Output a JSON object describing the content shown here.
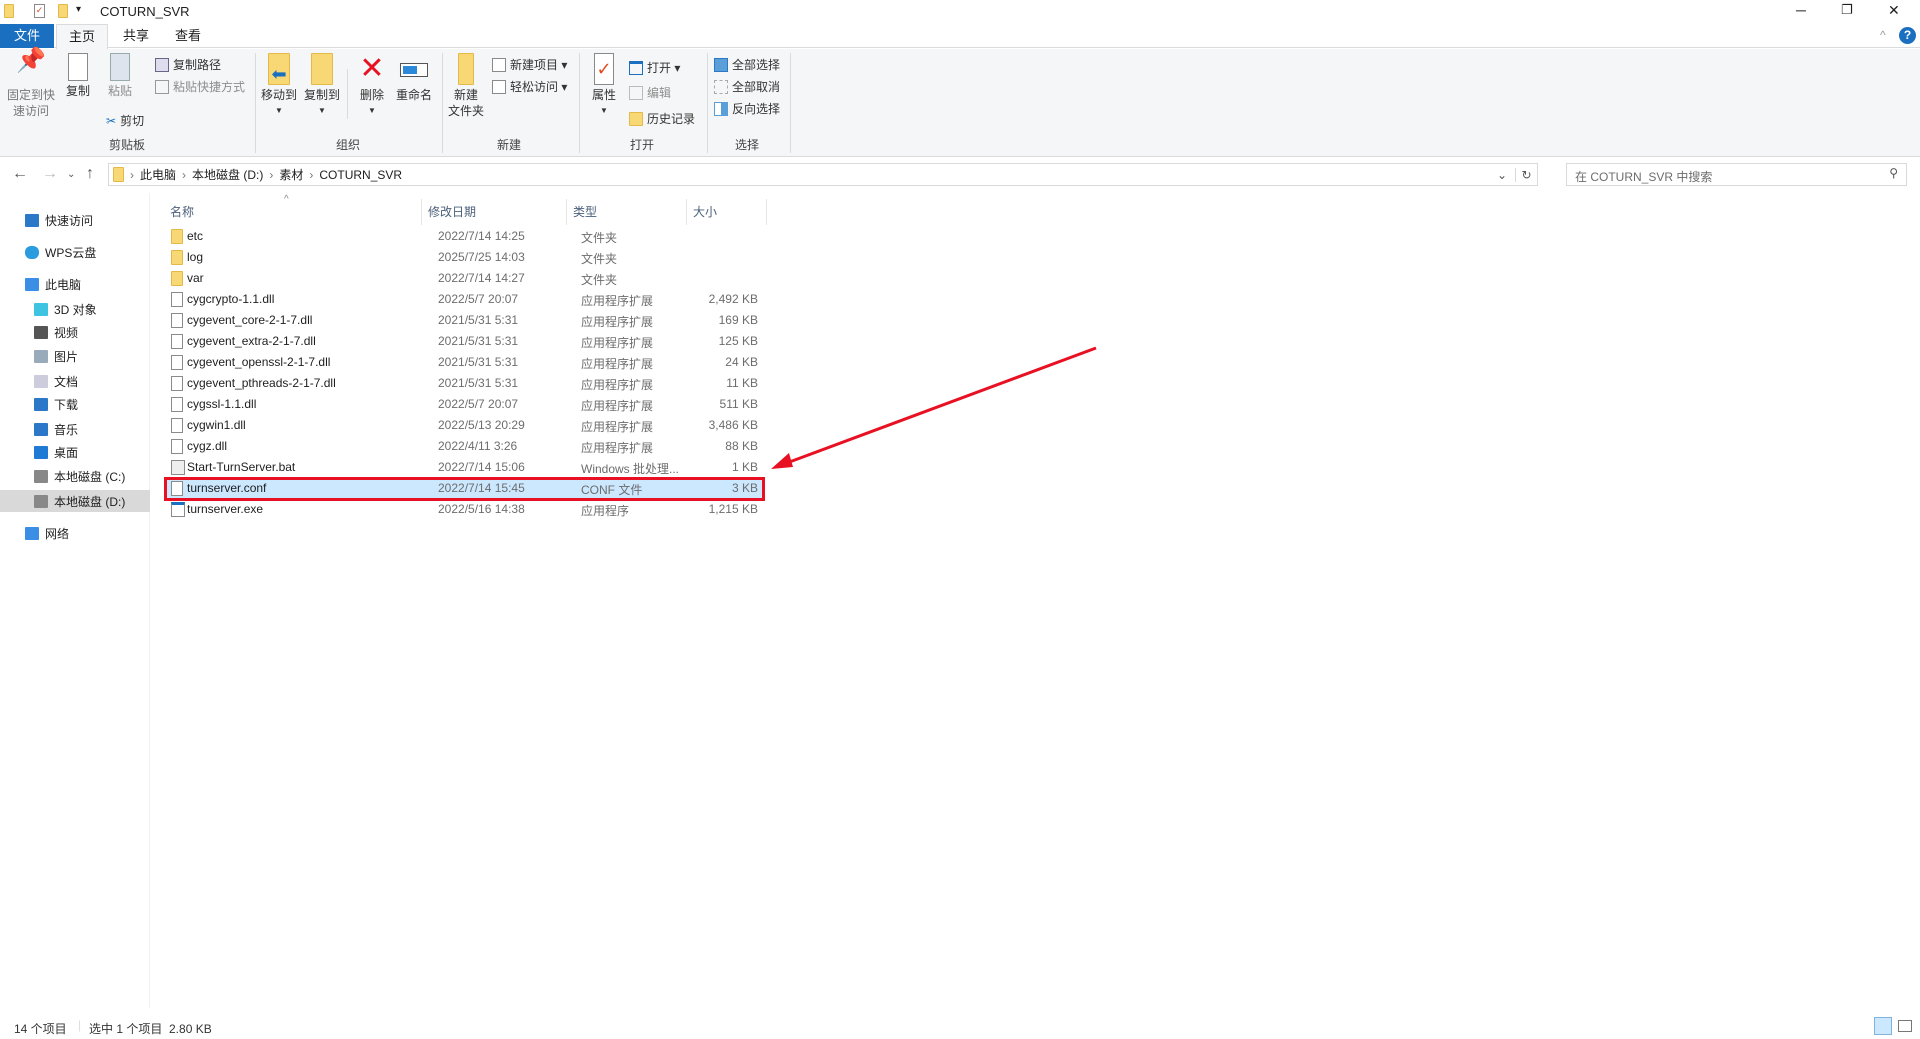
{
  "window": {
    "title": "COTURN_SVR",
    "minimize": "─",
    "restore": "❐",
    "close": "✕",
    "help": "?",
    "collapse": "^"
  },
  "tabs": [
    "文件",
    "主页",
    "共享",
    "查看"
  ],
  "ribbon": {
    "clipboard": {
      "pin": [
        "固定到快",
        "速访问"
      ],
      "copy": "复制",
      "paste": "粘贴",
      "copy_path": "复制路径",
      "paste_shortcut": "粘贴快捷方式",
      "cut": "剪切",
      "label": "剪贴板"
    },
    "organize": {
      "move_to": "移动到",
      "copy_to": "复制到",
      "delete": "删除",
      "rename": "重命名",
      "label": "组织"
    },
    "new": {
      "new_folder": [
        "新建",
        "文件夹"
      ],
      "new_item": "新建项目 ▾",
      "easy_access": "轻松访问 ▾",
      "label": "新建"
    },
    "open": {
      "properties": "属性",
      "open": "打开 ▾",
      "edit": "编辑",
      "history": "历史记录",
      "label": "打开"
    },
    "select": {
      "select_all": "全部选择",
      "select_none": "全部取消",
      "invert": "反向选择",
      "label": "选择"
    }
  },
  "address": {
    "crumbs": [
      "此电脑",
      "本地磁盘 (D:)",
      "素材",
      "COTURN_SVR"
    ],
    "search_placeholder": "在 COTURN_SVR 中搜索"
  },
  "sidebar": [
    {
      "label": "快速访问",
      "icon": "star-icon",
      "indent": 0
    },
    {
      "label": "WPS云盘",
      "icon": "cloud-icon",
      "indent": 0
    },
    {
      "label": "此电脑",
      "icon": "computer-icon",
      "indent": 0
    },
    {
      "label": "3D 对象",
      "icon": "cube-icon",
      "indent": 1
    },
    {
      "label": "视频",
      "icon": "video-icon",
      "indent": 1
    },
    {
      "label": "图片",
      "icon": "picture-icon",
      "indent": 1
    },
    {
      "label": "文档",
      "icon": "document-icon",
      "indent": 1
    },
    {
      "label": "下载",
      "icon": "download-icon",
      "indent": 1
    },
    {
      "label": "音乐",
      "icon": "music-icon",
      "indent": 1
    },
    {
      "label": "桌面",
      "icon": "desktop-icon",
      "indent": 1
    },
    {
      "label": "本地磁盘 (C:)",
      "icon": "drive-icon",
      "indent": 1
    },
    {
      "label": "本地磁盘 (D:)",
      "icon": "drive-icon",
      "indent": 1,
      "selected": true
    },
    {
      "label": "网络",
      "icon": "network-icon",
      "indent": 0
    }
  ],
  "columns": [
    "名称",
    "修改日期",
    "类型",
    "大小"
  ],
  "files": [
    {
      "name": "etc",
      "date": "2022/7/14 14:25",
      "type": "文件夹",
      "size": "",
      "kind": "folder"
    },
    {
      "name": "log",
      "date": "2025/7/25 14:03",
      "type": "文件夹",
      "size": "",
      "kind": "folder"
    },
    {
      "name": "var",
      "date": "2022/7/14 14:27",
      "type": "文件夹",
      "size": "",
      "kind": "folder"
    },
    {
      "name": "cygcrypto-1.1.dll",
      "date": "2022/5/7 20:07",
      "type": "应用程序扩展",
      "size": "2,492 KB",
      "kind": "dll"
    },
    {
      "name": "cygevent_core-2-1-7.dll",
      "date": "2021/5/31 5:31",
      "type": "应用程序扩展",
      "size": "169 KB",
      "kind": "dll"
    },
    {
      "name": "cygevent_extra-2-1-7.dll",
      "date": "2021/5/31 5:31",
      "type": "应用程序扩展",
      "size": "125 KB",
      "kind": "dll"
    },
    {
      "name": "cygevent_openssl-2-1-7.dll",
      "date": "2021/5/31 5:31",
      "type": "应用程序扩展",
      "size": "24 KB",
      "kind": "dll"
    },
    {
      "name": "cygevent_pthreads-2-1-7.dll",
      "date": "2021/5/31 5:31",
      "type": "应用程序扩展",
      "size": "11 KB",
      "kind": "dll"
    },
    {
      "name": "cygssl-1.1.dll",
      "date": "2022/5/7 20:07",
      "type": "应用程序扩展",
      "size": "511 KB",
      "kind": "dll"
    },
    {
      "name": "cygwin1.dll",
      "date": "2022/5/13 20:29",
      "type": "应用程序扩展",
      "size": "3,486 KB",
      "kind": "dll"
    },
    {
      "name": "cygz.dll",
      "date": "2022/4/11 3:26",
      "type": "应用程序扩展",
      "size": "88 KB",
      "kind": "dll"
    },
    {
      "name": "Start-TurnServer.bat",
      "date": "2022/7/14 15:06",
      "type": "Windows 批处理...",
      "size": "1 KB",
      "kind": "bat"
    },
    {
      "name": "turnserver.conf",
      "date": "2022/7/14 15:45",
      "type": "CONF 文件",
      "size": "3 KB",
      "kind": "conf",
      "selected": true
    },
    {
      "name": "turnserver.exe",
      "date": "2022/5/16 14:38",
      "type": "应用程序",
      "size": "1,215 KB",
      "kind": "exe"
    }
  ],
  "status": {
    "count": "14 个项目",
    "selection": "选中 1 个项目  2.80 KB"
  },
  "colors": {
    "accent": "#1a6fc1",
    "selection": "#cce8ff",
    "highlight": "#e81123"
  }
}
